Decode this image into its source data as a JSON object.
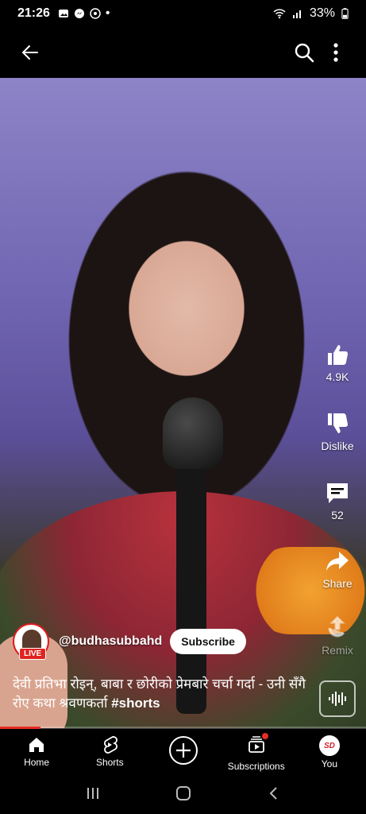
{
  "status_bar": {
    "time": "21:26",
    "dot": "•",
    "battery": "33%",
    "left_icons": [
      "gallery-icon",
      "messenger-icon",
      "viber-icon"
    ],
    "right_icons": [
      "wifi-icon",
      "signal-icon",
      "battery-icon"
    ]
  },
  "top_bar": {
    "back_icon": "back-arrow-icon",
    "search_icon": "search-icon",
    "more_icon": "more-vertical-icon"
  },
  "actions": {
    "like_count": "4.9K",
    "dislike_label": "Dislike",
    "comment_count": "52",
    "share_label": "Share",
    "remix_label": "Remix"
  },
  "channel": {
    "handle": "@budhasubbahd",
    "live_badge": "LIVE",
    "subscribe_label": "Subscribe"
  },
  "caption": {
    "text": "देवी प्रतिभा रोइन्, बाबा र छोरीको प्रेमबारे चर्चा गर्दा - उनी सँगै रोए कथा श्रवणकर्ता ",
    "hashtag": "#shorts"
  },
  "progress_fraction": 0.11,
  "bottom_nav": {
    "home": "Home",
    "shorts": "Shorts",
    "subscriptions": "Subscriptions",
    "you": "You",
    "you_avatar_text": "SD"
  },
  "colors": {
    "accent_red": "#e52d27",
    "background": "#000000",
    "subscribe_bg": "#ffffff"
  }
}
